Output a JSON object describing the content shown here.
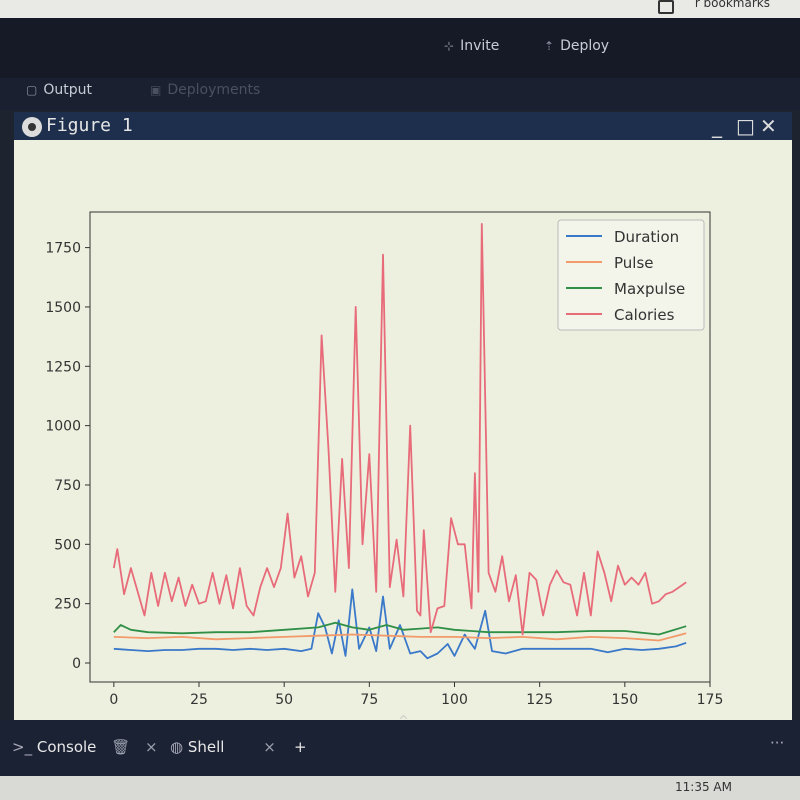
{
  "browser": {
    "bookmarks_label": "r bookmarks"
  },
  "ide": {
    "invite_label": "Invite",
    "deploy_label": "Deploy",
    "tabs": [
      {
        "label": "Output"
      },
      {
        "label": "Deployments"
      }
    ]
  },
  "figure": {
    "title": "Figure 1"
  },
  "bottom": {
    "console_label": "Console",
    "shell_label": "Shell",
    "add_label": "+",
    "more_label": "···",
    "expand_label": "^"
  },
  "taskbar": {
    "time": "11:35 AM"
  },
  "colors": {
    "duration": "#3a78c9",
    "pulse": "#f29a6a",
    "maxpulse": "#2f8f46",
    "calories": "#e86b7a"
  },
  "chart_data": {
    "type": "line",
    "xlim": [
      -7,
      175
    ],
    "ylim": [
      -80,
      1900
    ],
    "x_ticks": [
      0,
      25,
      50,
      75,
      100,
      125,
      150,
      175
    ],
    "y_ticks": [
      0,
      250,
      500,
      750,
      1000,
      1250,
      1500,
      1750
    ],
    "legend": "top-right",
    "grid": false,
    "series": [
      {
        "name": "Duration",
        "color": "#3a78c9",
        "points": [
          [
            0,
            60
          ],
          [
            5,
            55
          ],
          [
            10,
            50
          ],
          [
            15,
            55
          ],
          [
            20,
            55
          ],
          [
            25,
            60
          ],
          [
            30,
            60
          ],
          [
            35,
            55
          ],
          [
            40,
            60
          ],
          [
            45,
            55
          ],
          [
            50,
            60
          ],
          [
            55,
            50
          ],
          [
            58,
            60
          ],
          [
            60,
            210
          ],
          [
            62,
            150
          ],
          [
            64,
            40
          ],
          [
            66,
            180
          ],
          [
            68,
            30
          ],
          [
            70,
            310
          ],
          [
            72,
            60
          ],
          [
            75,
            150
          ],
          [
            77,
            50
          ],
          [
            79,
            280
          ],
          [
            81,
            60
          ],
          [
            84,
            160
          ],
          [
            87,
            40
          ],
          [
            90,
            50
          ],
          [
            92,
            20
          ],
          [
            95,
            40
          ],
          [
            98,
            80
          ],
          [
            100,
            30
          ],
          [
            103,
            120
          ],
          [
            106,
            60
          ],
          [
            109,
            220
          ],
          [
            111,
            50
          ],
          [
            115,
            40
          ],
          [
            120,
            60
          ],
          [
            125,
            60
          ],
          [
            130,
            60
          ],
          [
            135,
            60
          ],
          [
            140,
            60
          ],
          [
            145,
            45
          ],
          [
            150,
            60
          ],
          [
            155,
            55
          ],
          [
            160,
            60
          ],
          [
            165,
            70
          ],
          [
            168,
            85
          ]
        ]
      },
      {
        "name": "Pulse",
        "color": "#f29a6a",
        "points": [
          [
            0,
            110
          ],
          [
            10,
            105
          ],
          [
            20,
            110
          ],
          [
            30,
            100
          ],
          [
            40,
            105
          ],
          [
            50,
            110
          ],
          [
            60,
            115
          ],
          [
            70,
            120
          ],
          [
            80,
            115
          ],
          [
            90,
            110
          ],
          [
            100,
            110
          ],
          [
            110,
            105
          ],
          [
            120,
            110
          ],
          [
            130,
            100
          ],
          [
            140,
            110
          ],
          [
            150,
            105
          ],
          [
            160,
            95
          ],
          [
            168,
            125
          ]
        ]
      },
      {
        "name": "Maxpulse",
        "color": "#2f8f46",
        "points": [
          [
            0,
            130
          ],
          [
            2,
            160
          ],
          [
            5,
            140
          ],
          [
            10,
            130
          ],
          [
            20,
            125
          ],
          [
            30,
            130
          ],
          [
            40,
            130
          ],
          [
            50,
            140
          ],
          [
            60,
            150
          ],
          [
            65,
            170
          ],
          [
            70,
            150
          ],
          [
            75,
            140
          ],
          [
            80,
            160
          ],
          [
            85,
            140
          ],
          [
            90,
            145
          ],
          [
            95,
            150
          ],
          [
            100,
            140
          ],
          [
            105,
            135
          ],
          [
            110,
            130
          ],
          [
            120,
            130
          ],
          [
            130,
            130
          ],
          [
            140,
            135
          ],
          [
            150,
            135
          ],
          [
            160,
            120
          ],
          [
            168,
            155
          ]
        ]
      },
      {
        "name": "Calories",
        "color": "#e86b7a",
        "points": [
          [
            0,
            400
          ],
          [
            1,
            480
          ],
          [
            3,
            290
          ],
          [
            5,
            400
          ],
          [
            7,
            300
          ],
          [
            9,
            200
          ],
          [
            11,
            380
          ],
          [
            13,
            240
          ],
          [
            15,
            380
          ],
          [
            17,
            260
          ],
          [
            19,
            360
          ],
          [
            21,
            240
          ],
          [
            23,
            330
          ],
          [
            25,
            250
          ],
          [
            27,
            260
          ],
          [
            29,
            380
          ],
          [
            31,
            250
          ],
          [
            33,
            370
          ],
          [
            35,
            230
          ],
          [
            37,
            400
          ],
          [
            39,
            240
          ],
          [
            41,
            200
          ],
          [
            43,
            320
          ],
          [
            45,
            400
          ],
          [
            47,
            320
          ],
          [
            49,
            400
          ],
          [
            51,
            630
          ],
          [
            53,
            360
          ],
          [
            55,
            450
          ],
          [
            57,
            280
          ],
          [
            59,
            380
          ],
          [
            61,
            1380
          ],
          [
            63,
            900
          ],
          [
            65,
            300
          ],
          [
            67,
            860
          ],
          [
            69,
            400
          ],
          [
            71,
            1500
          ],
          [
            73,
            500
          ],
          [
            75,
            880
          ],
          [
            77,
            300
          ],
          [
            79,
            1720
          ],
          [
            81,
            320
          ],
          [
            83,
            520
          ],
          [
            85,
            280
          ],
          [
            87,
            1000
          ],
          [
            89,
            220
          ],
          [
            90,
            200
          ],
          [
            91,
            560
          ],
          [
            93,
            130
          ],
          [
            95,
            230
          ],
          [
            97,
            240
          ],
          [
            99,
            610
          ],
          [
            101,
            500
          ],
          [
            103,
            500
          ],
          [
            105,
            230
          ],
          [
            106,
            800
          ],
          [
            107,
            300
          ],
          [
            108,
            1850
          ],
          [
            110,
            380
          ],
          [
            112,
            300
          ],
          [
            114,
            450
          ],
          [
            116,
            260
          ],
          [
            118,
            370
          ],
          [
            120,
            120
          ],
          [
            122,
            380
          ],
          [
            124,
            350
          ],
          [
            126,
            200
          ],
          [
            128,
            330
          ],
          [
            130,
            390
          ],
          [
            132,
            340
          ],
          [
            134,
            330
          ],
          [
            136,
            200
          ],
          [
            138,
            380
          ],
          [
            140,
            200
          ],
          [
            142,
            470
          ],
          [
            144,
            380
          ],
          [
            146,
            260
          ],
          [
            148,
            410
          ],
          [
            150,
            330
          ],
          [
            152,
            360
          ],
          [
            154,
            330
          ],
          [
            156,
            380
          ],
          [
            158,
            250
          ],
          [
            160,
            260
          ],
          [
            162,
            290
          ],
          [
            164,
            300
          ],
          [
            166,
            320
          ],
          [
            168,
            340
          ]
        ]
      }
    ]
  }
}
